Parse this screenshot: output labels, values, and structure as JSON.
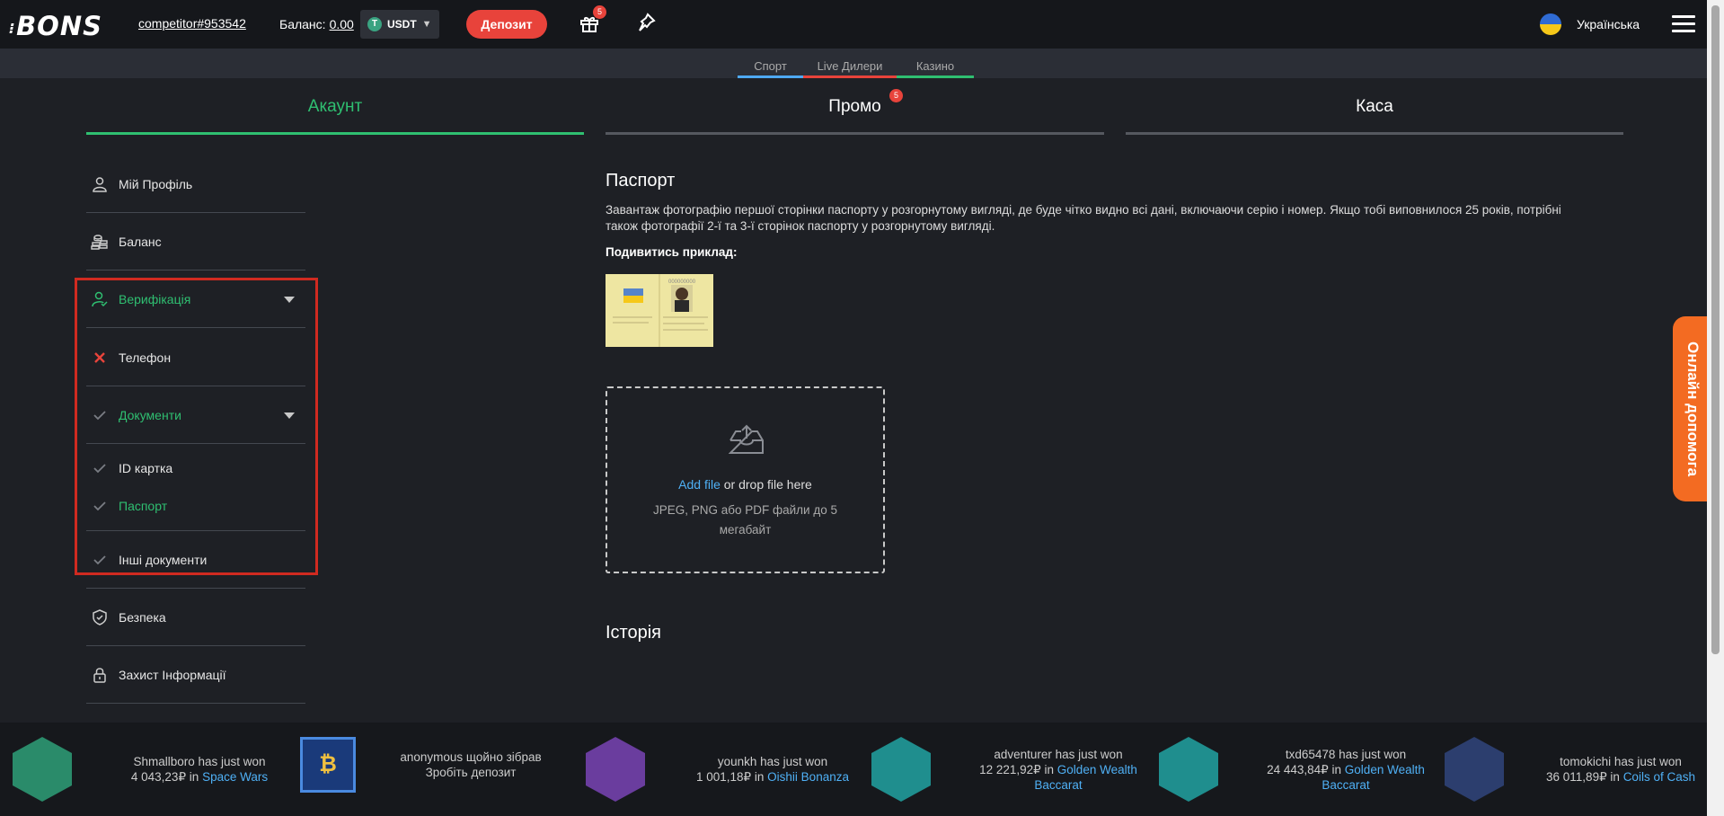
{
  "header": {
    "logo": "BONS",
    "username": "competitor#953542",
    "balance_label": "Баланс:",
    "balance_value": "0.00",
    "currency": "USDT",
    "deposit_label": "Депозит",
    "gift_badge": "5",
    "language": "Українська"
  },
  "subnav": {
    "tabs": [
      {
        "label": "Спорт",
        "color": "#4ea9f3"
      },
      {
        "label": "Live Дилери",
        "color": "#e8433b"
      },
      {
        "label": "Казино",
        "color": "#2fbf71"
      }
    ]
  },
  "main_tabs": {
    "account": "Акаунт",
    "promo": "Промо",
    "promo_badge": "5",
    "cashier": "Каса",
    "active_color": "#2fbf71"
  },
  "sidebar": {
    "items": [
      {
        "label": "Мій Профіль",
        "icon": "user-icon"
      },
      {
        "label": "Баланс",
        "icon": "coins-icon"
      },
      {
        "label": "Верифікація",
        "icon": "user-check-icon"
      },
      {
        "label": "Телефон",
        "icon": "cross-icon"
      },
      {
        "label": "Документи",
        "icon": "check-icon"
      },
      {
        "label": "ID картка",
        "icon": "check-icon"
      },
      {
        "label": "Паспорт",
        "icon": "check-icon"
      },
      {
        "label": "Інші документи",
        "icon": "check-icon"
      },
      {
        "label": "Безпека",
        "icon": "shield-icon"
      },
      {
        "label": "Захист Інформації",
        "icon": "lock-icon"
      }
    ]
  },
  "content": {
    "title": "Паспорт",
    "description": "Завантаж фотографію першої сторінки паспорту у розгорнутому вигляді, де буде чітко видно всі дані, включаючи серію і номер. Якщо тобі виповнилося 25 років, потрібні також фотографії 2-ї та 3-ї сторінок паспорту у розгорнутому вигляді.",
    "example_label": "Подивитись приклад:",
    "dropzone": {
      "link": "Add file",
      "text": " or drop file here",
      "hint": "JPEG, PNG або PDF файли до 5 мегабайт"
    },
    "history_title": "Історія"
  },
  "help_tab": "Онлайн допомога",
  "ticker": [
    {
      "text": "Shmallboro has just won",
      "amount": "4 043,23₽ in",
      "game": "Space Wars"
    },
    {
      "text": "anonymous щойно зібрав",
      "amount": "Зробіть депозит",
      "game": ""
    },
    {
      "text": "younkh has just won",
      "amount": "1 001,18₽ in",
      "game": "Oishii Bonanza"
    },
    {
      "text": "adventurer has just won",
      "amount": "12 221,92₽ in",
      "game": "Golden Wealth Baccarat"
    },
    {
      "text": "txd65478 has just won",
      "amount": "24 443,84₽ in",
      "game": "Golden Wealth Baccarat"
    },
    {
      "text": "tomokichi has just won",
      "amount": "36 011,89₽ in",
      "game": "Coils of Cash"
    }
  ]
}
